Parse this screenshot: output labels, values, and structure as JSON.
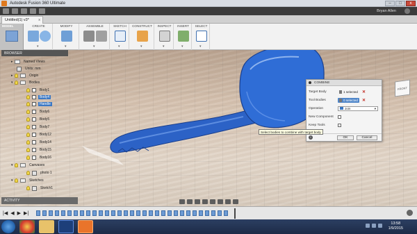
{
  "window": {
    "title": "Autodesk Fusion 360 Ultimate",
    "min": "–",
    "max": "□",
    "close": "x"
  },
  "toolbar": {
    "user": "Bryan Allen"
  },
  "document": {
    "tab_label": "Untitled(1) v3*",
    "close": "x"
  },
  "ribbon": {
    "workspace": "MODEL",
    "groups": [
      "CREATE",
      "MODIFY",
      "ASSEMBLE",
      "SKETCH",
      "CONSTRUCT",
      "INSPECT",
      "INSERT",
      "SELECT"
    ],
    "caret": "▾"
  },
  "browser": {
    "header": "BROWSER",
    "items": [
      {
        "label": "Named Views"
      },
      {
        "label": "Units: mm"
      },
      {
        "label": "Origin"
      },
      {
        "label": "Bodies"
      },
      {
        "label": "Body1"
      },
      {
        "label": "Body4"
      },
      {
        "label": "Handle"
      },
      {
        "label": "Body6"
      },
      {
        "label": "Body5"
      },
      {
        "label": "Body7"
      },
      {
        "label": "Body12"
      },
      {
        "label": "Body14"
      },
      {
        "label": "Body15"
      },
      {
        "label": "Body16"
      },
      {
        "label": "Canvases"
      },
      {
        "label": "photo 1"
      },
      {
        "label": "Sketches"
      },
      {
        "label": "Sketch1"
      }
    ]
  },
  "combine": {
    "title": "COMBINE",
    "target_body_label": "Target Body",
    "target_body_value": "1 selected",
    "tool_bodies_label": "Tool Bodies",
    "tool_bodies_value": "0 selected",
    "operation_label": "Operation",
    "operation_value": "Join",
    "new_component_label": "New Component",
    "keep_tools_label": "Keep Tools",
    "ok_label": "OK",
    "cancel_label": "Cancel",
    "info": "i",
    "remove": "✕"
  },
  "tooltip": "Select bodies to combine with target body",
  "activity": {
    "label": "ACTIVITY"
  },
  "viewcube": {
    "face": "FRONT"
  },
  "timeline": {
    "controls": [
      "|◀",
      "◀",
      "▶",
      "▶|"
    ]
  },
  "taskbar": {
    "time": "13:58",
    "date": "1/9/2015"
  },
  "colors": {
    "accent": "#3b78c4",
    "model_blue": "#2c66c9",
    "ribbon_bg": "#f2f2f2"
  }
}
